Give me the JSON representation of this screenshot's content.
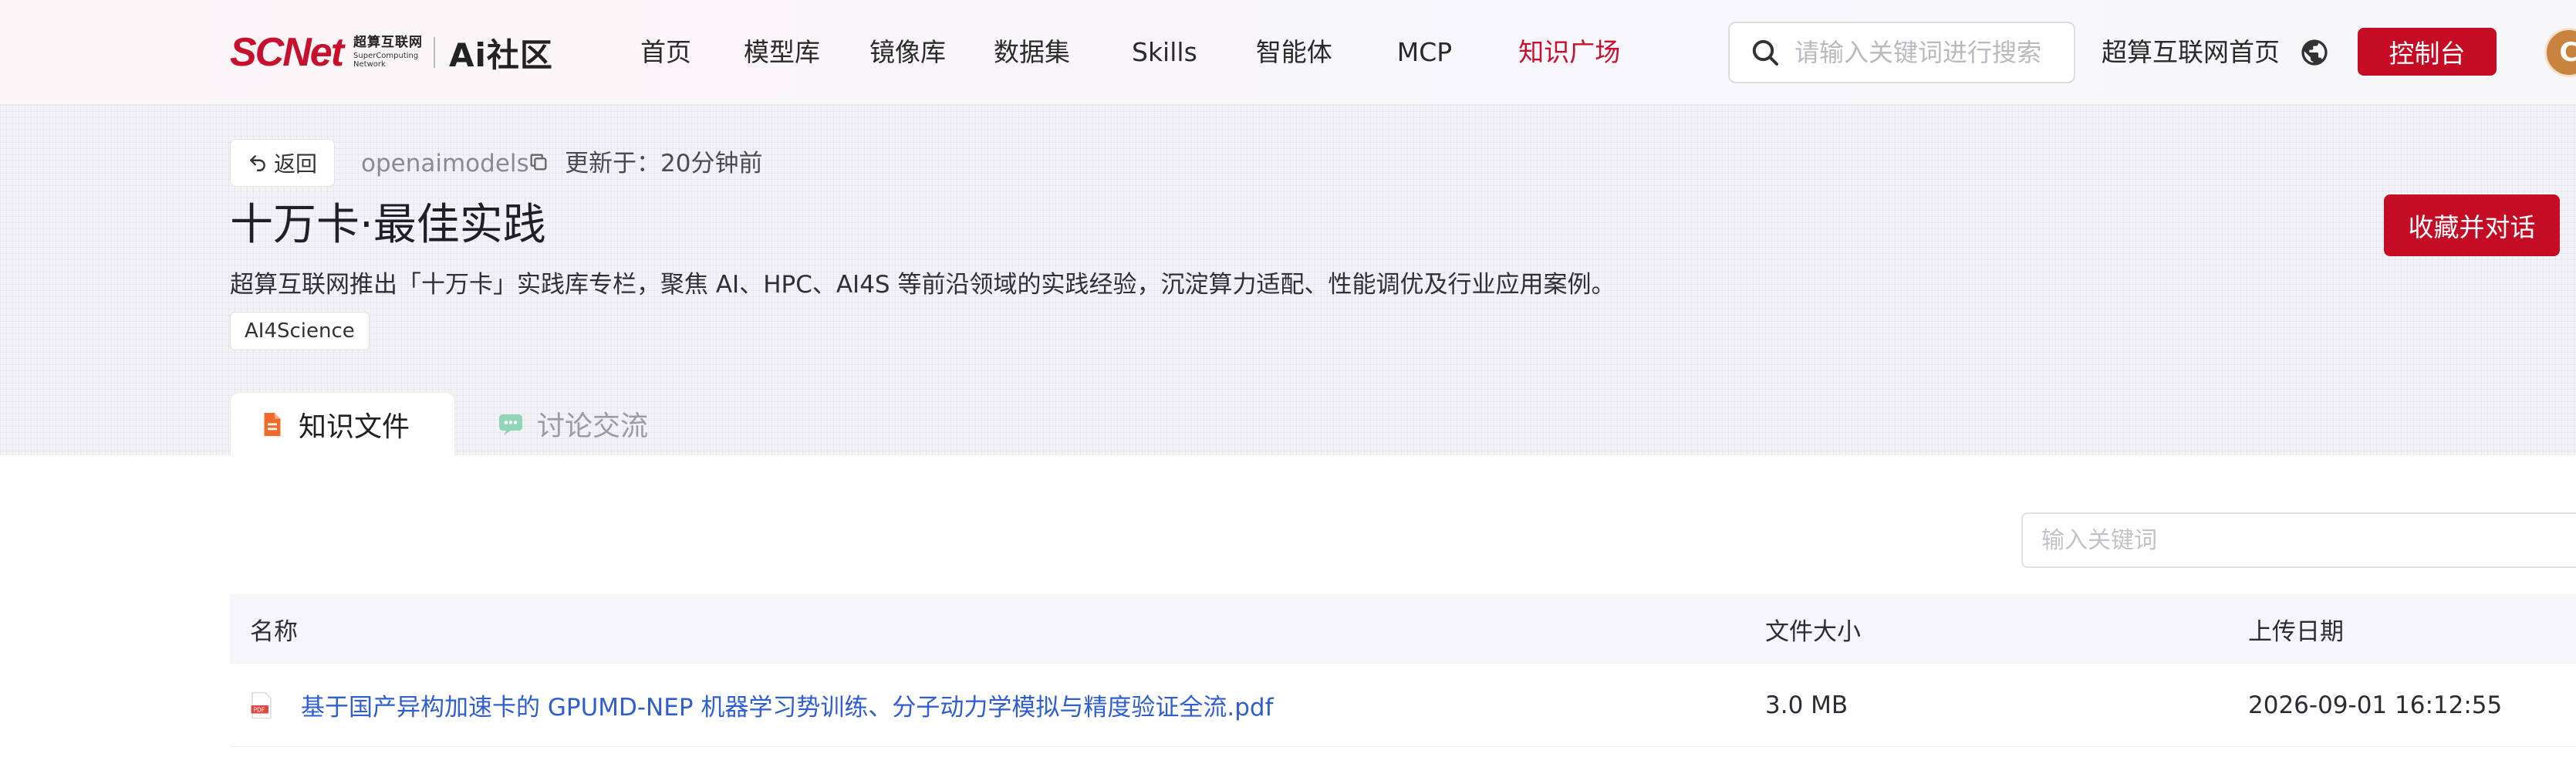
{
  "header": {
    "logo_text": "SCNet",
    "logo_cn": "超算互联网",
    "logo_en": "SuperComputing Network",
    "logo_ai": "Ai社区",
    "nav": [
      {
        "label": "首页"
      },
      {
        "label": "模型库"
      },
      {
        "label": "镜像库"
      },
      {
        "label": "数据集"
      },
      {
        "label": "Skills"
      },
      {
        "label": "智能体"
      },
      {
        "label": "MCP"
      },
      {
        "label": "知识广场",
        "active": true
      }
    ],
    "search_placeholder": "请输入关键词进行搜索",
    "home_link": "超算互联网首页",
    "console_label": "控制台",
    "avatar_letter": "C"
  },
  "banner": {
    "back_label": "返回",
    "author": "openaimodels",
    "updated": "更新于：20分钟前",
    "title": "十万卡·最佳实践",
    "favorite_label": "收藏并对话",
    "description": "超算互联网推出「十万卡」实践库专栏，聚焦 AI、HPC、AI4S 等前沿领域的实践经验，沉淀算力适配、性能调优及行业应用案例。",
    "tag": "AI4Science",
    "tabs": [
      {
        "label": "知识文件",
        "active": true,
        "icon": "document-icon"
      },
      {
        "label": "讨论交流",
        "active": false,
        "icon": "chat-icon"
      }
    ]
  },
  "files": {
    "filter_placeholder": "输入关键词",
    "columns": [
      "名称",
      "文件大小",
      "上传日期"
    ],
    "rows": [
      {
        "name": "基于国产异构加速卡的 GPUMD-NEP 机器学习势训练、分子动力学模拟与精度验证全流.pdf",
        "size": "3.0 MB",
        "date": "2026-09-01 16:12:55"
      }
    ]
  },
  "colors": {
    "brand": "#c8102e",
    "button": "#c40d24",
    "link": "#2f5fcf"
  }
}
